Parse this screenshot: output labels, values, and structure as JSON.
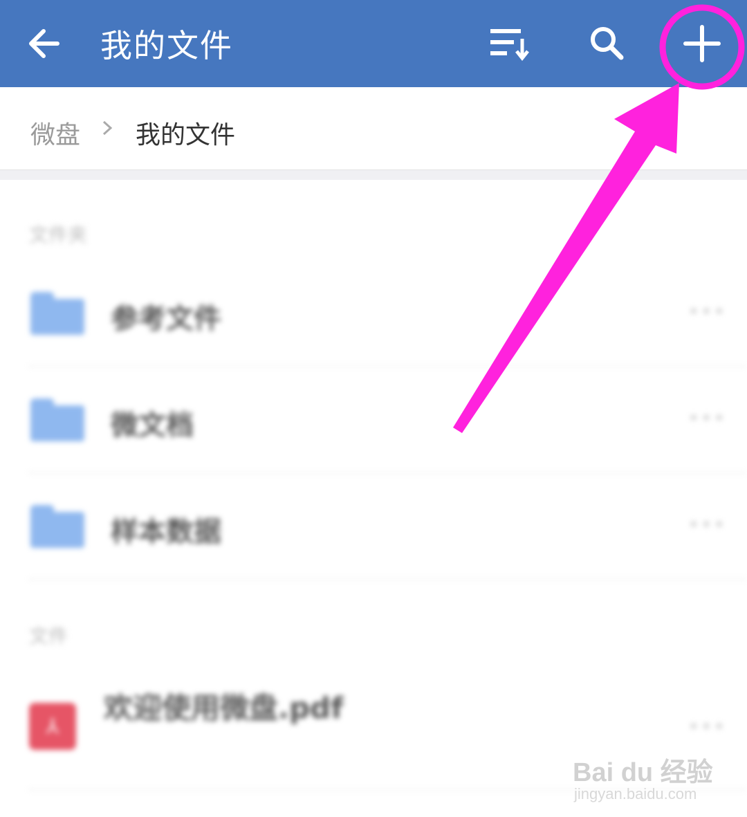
{
  "header": {
    "title": "我的文件",
    "back_icon": "arrow-left-icon",
    "sort_icon": "sort-icon",
    "search_icon": "search-icon",
    "add_icon": "plus-icon",
    "bar_color": "#4677bf"
  },
  "breadcrumb": {
    "root": "微盘",
    "current": "我的文件"
  },
  "folders_section": {
    "label": "文件夹",
    "items": [
      {
        "name": "参考文件",
        "more": "•••"
      },
      {
        "name": "微文档",
        "more": "•••"
      },
      {
        "name": "样本数据",
        "more": "•••"
      }
    ]
  },
  "files_section": {
    "label": "文件",
    "items": [
      {
        "name": "欢迎使用微盘.pdf",
        "more": "•••"
      }
    ]
  },
  "annotation": {
    "color": "#ff22dd",
    "target": "add-button"
  },
  "watermark": {
    "main": "Bai du 经验",
    "sub": "jingyan.baidu.com"
  }
}
